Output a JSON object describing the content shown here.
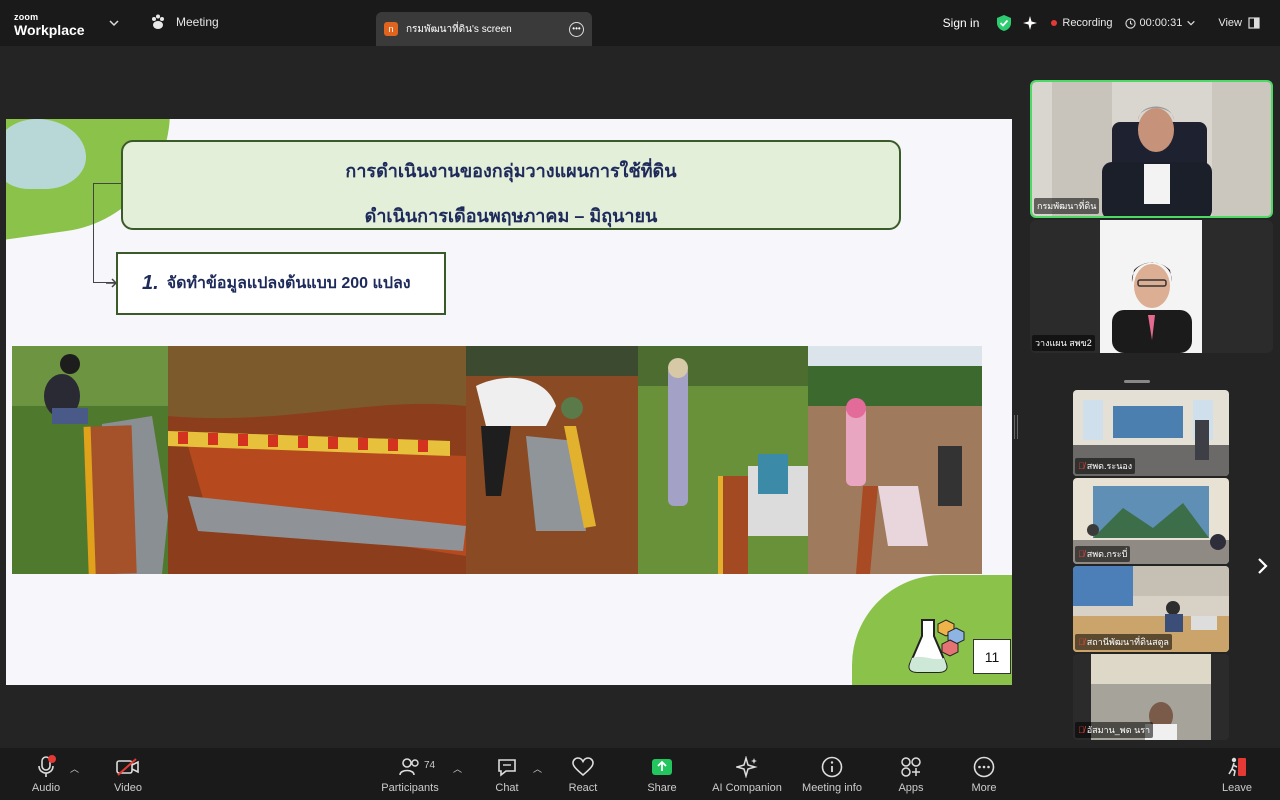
{
  "app": {
    "brand_small": "zoom",
    "brand_large": "Workplace"
  },
  "header": {
    "meeting_label": "Meeting",
    "share_tab": {
      "avatar_letter": "n",
      "title": "กรมพัฒนาที่ดิน's screen"
    },
    "signin_label": "Sign in",
    "recording_label": "Recording",
    "timer": "00:00:31",
    "view_label": "View"
  },
  "slide": {
    "title_line1": "การดำเนินงานของกลุ่มวางแผนการใช้ที่ดิน",
    "title_line2": "ดำเนินการเดือนพฤษภาคม – มิถุนายน",
    "point_number": "1.",
    "point_text": "จัดทำข้อมูลแปลงต้นแบบ 200 แปลง",
    "page_number": "11"
  },
  "speakers": [
    {
      "name": "กรมพัฒนาที่ดิน"
    },
    {
      "name": "วางแผน สพข2"
    }
  ],
  "gallery": [
    {
      "name": "สพด.ระนอง"
    },
    {
      "name": "สพด.กระบี่"
    },
    {
      "name": "สถานีพัฒนาที่ดินสตูล"
    },
    {
      "name": "อัสมาน_พด นรา"
    }
  ],
  "toolbar": {
    "audio": "Audio",
    "video": "Video",
    "participants": "Participants",
    "participants_count": "74",
    "chat": "Chat",
    "react": "React",
    "share": "Share",
    "ai_companion": "AI Companion",
    "meeting_info": "Meeting info",
    "apps": "Apps",
    "more": "More",
    "leave": "Leave"
  },
  "colors": {
    "accent_green": "#2ecc71",
    "record_red": "#e53935",
    "slide_green": "#8bc34a",
    "share_green": "#22c55e"
  }
}
